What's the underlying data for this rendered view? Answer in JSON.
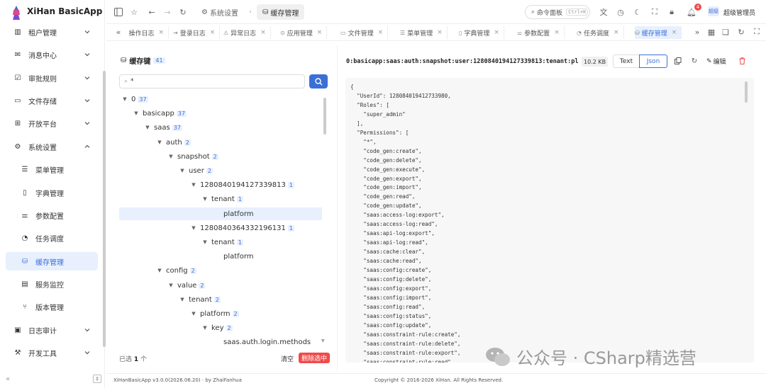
{
  "app": {
    "title": "XiHan BasicApp"
  },
  "sidebar": {
    "items": [
      {
        "label": "租户管理",
        "icon": "building-icon",
        "expandable": true
      },
      {
        "label": "消息中心",
        "icon": "mail-icon",
        "expandable": true
      },
      {
        "label": "审批规则",
        "icon": "clipboard-check-icon",
        "expandable": true
      },
      {
        "label": "文件存储",
        "icon": "folder-icon",
        "expandable": true
      },
      {
        "label": "开放平台",
        "icon": "grid-plus-icon",
        "expandable": true
      },
      {
        "label": "系统设置",
        "icon": "gear-icon",
        "expandable": true,
        "expanded": true
      },
      {
        "label": "菜单管理",
        "icon": "list-tree-icon",
        "child": true
      },
      {
        "label": "字典管理",
        "icon": "book-icon",
        "child": true
      },
      {
        "label": "参数配置",
        "icon": "sliders-icon",
        "child": true
      },
      {
        "label": "任务调度",
        "icon": "timer-icon",
        "child": true
      },
      {
        "label": "缓存管理",
        "icon": "database-icon",
        "child": true,
        "active": true
      },
      {
        "label": "服务监控",
        "icon": "server-icon",
        "child": true
      },
      {
        "label": "版本管理",
        "icon": "git-branch-icon",
        "child": true
      },
      {
        "label": "日志审计",
        "icon": "log-file-icon",
        "expandable": true
      },
      {
        "label": "开发工具",
        "icon": "hammer-icon",
        "expandable": true
      }
    ]
  },
  "header": {
    "breadcrumbs": [
      "系统设置",
      "缓存管理"
    ],
    "command_palette": {
      "label": "命令面板",
      "shortcut": "Ctrl+K"
    },
    "notification_count": "4",
    "avatar_text": "超级",
    "user_name": "超级管理员"
  },
  "tabs": [
    {
      "label": "操作日志",
      "icon": "edit-icon"
    },
    {
      "label": "登录日志",
      "icon": "login-icon"
    },
    {
      "label": "异常日志",
      "icon": "warning-icon"
    },
    {
      "label": "应用管理",
      "icon": "app-icon"
    },
    {
      "label": "文件管理",
      "icon": "folder-icon"
    },
    {
      "label": "菜单管理",
      "icon": "list-icon"
    },
    {
      "label": "字典管理",
      "icon": "book-icon"
    },
    {
      "label": "参数配置",
      "icon": "sliders-icon"
    },
    {
      "label": "任务调度",
      "icon": "timer-icon"
    },
    {
      "label": "缓存管理",
      "icon": "database-icon",
      "active": true
    }
  ],
  "cache_keys": {
    "title": "缓存键",
    "count": "41",
    "search_value": "*",
    "tree": [
      {
        "label": "0",
        "count": "37",
        "level": 0,
        "expanded": true
      },
      {
        "label": "basicapp",
        "count": "37",
        "level": 1,
        "expanded": true
      },
      {
        "label": "saas",
        "count": "37",
        "level": 2,
        "expanded": true
      },
      {
        "label": "auth",
        "count": "2",
        "level": 3,
        "expanded": true
      },
      {
        "label": "snapshot",
        "count": "2",
        "level": 4,
        "expanded": true
      },
      {
        "label": "user",
        "count": "2",
        "level": 5,
        "expanded": true
      },
      {
        "label": "1280840194127339813",
        "count": "1",
        "level": 6,
        "expanded": true
      },
      {
        "label": "tenant",
        "count": "1",
        "level": 7,
        "expanded": true
      },
      {
        "label": "platform",
        "count": "",
        "level": 8,
        "leaf": true,
        "selected": true
      },
      {
        "label": "1280840364332196131",
        "count": "1",
        "level": 6,
        "expanded": true
      },
      {
        "label": "tenant",
        "count": "1",
        "level": 7,
        "expanded": true
      },
      {
        "label": "platform",
        "count": "",
        "level": 8,
        "leaf": true
      },
      {
        "label": "config",
        "count": "2",
        "level": 3,
        "expanded": true
      },
      {
        "label": "value",
        "count": "2",
        "level": 4,
        "expanded": true
      },
      {
        "label": "tenant",
        "count": "2",
        "level": 5,
        "expanded": true
      },
      {
        "label": "platform",
        "count": "2",
        "level": 6,
        "expanded": true
      },
      {
        "label": "key",
        "count": "2",
        "level": 7,
        "expanded": true
      },
      {
        "label": "saas.auth.login.methods",
        "count": "",
        "level": 8,
        "leaf": true
      }
    ],
    "selected_prefix": "已选",
    "selected_count": "1",
    "selected_suffix": "个",
    "clear_label": "清空",
    "delete_selected_label": "删除选中"
  },
  "detail": {
    "key_path": "0:basicapp:saas:auth:snapshot:user:1280840194127339813:tenant:platfo…",
    "size": "10.2 KB",
    "text_tab": "Text",
    "json_tab": "Json",
    "edit_label": "编辑",
    "json_lines": [
      "{",
      "  \"UserId\": 128084019412733980,",
      "  \"Roles\": [",
      "    \"super_admin\"",
      "  ],",
      "  \"Permissions\": [",
      "    \"*\",",
      "    \"code_gen:create\",",
      "    \"code_gen:delete\",",
      "    \"code_gen:execute\",",
      "    \"code_gen:export\",",
      "    \"code_gen:import\",",
      "    \"code_gen:read\",",
      "    \"code_gen:update\",",
      "    \"saas:access-log:export\",",
      "    \"saas:access-log:read\",",
      "    \"saas:api-log:export\",",
      "    \"saas:api-log:read\",",
      "    \"saas:cache:clear\",",
      "    \"saas:cache:read\",",
      "    \"saas:config:create\",",
      "    \"saas:config:delete\",",
      "    \"saas:config:export\",",
      "    \"saas:config:import\",",
      "    \"saas:config:read\",",
      "    \"saas:config:status\",",
      "    \"saas:config:update\",",
      "    \"saas:constraint-rule:create\",",
      "    \"saas:constraint-rule:delete\",",
      "    \"saas:constraint-rule:export\",",
      "    \"saas:constraint-rule:read\""
    ]
  },
  "footer": {
    "version": "XiHanBasicApp v3.0.0(2026.06.20) · by ZhaiFanhua",
    "copyright": "Copyright © 2016-2026 XiHan. All Rights Reserved."
  },
  "watermark": {
    "text": "公众号 · CSharp精选营"
  },
  "colors": {
    "primary": "#3b6fd8",
    "danger": "#f04a4a",
    "active_bg": "#e8f0fe"
  }
}
